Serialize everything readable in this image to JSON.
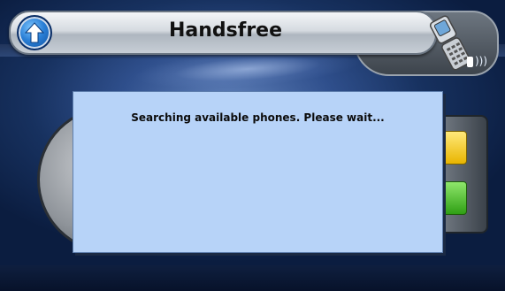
{
  "header": {
    "title": "Handsfree"
  },
  "icons": {
    "up": "up-arrow-icon",
    "phone": "flip-phone-icon",
    "bluetooth": "bluetooth-signal-icon"
  },
  "dialog": {
    "message": "Searching available phones. Please wait..."
  },
  "colors": {
    "dialog_bg": "#b7d3f8",
    "background": "#17315f",
    "accent_blue": "#2a7fd6"
  }
}
